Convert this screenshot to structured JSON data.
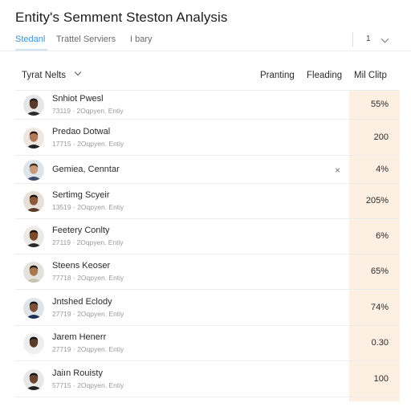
{
  "header": {
    "title": "Entity's Semment Steston Analysis"
  },
  "tabs": [
    {
      "label": "Stedanl",
      "active": true
    },
    {
      "label": "Trattel Serviers",
      "active": false
    },
    {
      "label": "I bary",
      "active": false
    }
  ],
  "pager": {
    "value": "1"
  },
  "table_header": {
    "filter_label": "Tyrat Nelts",
    "columns": [
      "Pranting",
      "Fleading",
      "Mil Clitp"
    ]
  },
  "rows": [
    {
      "name": "Snhiot Pwesl",
      "sub": "73119  ·  2Oqpyen. Entiy",
      "value": "55%",
      "avatar": {
        "skin": "#5a3a2a",
        "bg": "#e6e6e6",
        "shirt": "#2a2a2a",
        "hair": "#1a1a1a"
      }
    },
    {
      "name": "Predao Dotwal",
      "sub": "17715  ·  2Oqpyen. Entiy",
      "value": "200",
      "avatar": {
        "skin": "#b07a5a",
        "bg": "#efe6df",
        "shirt": "#222222",
        "hair": "#2a1810"
      }
    },
    {
      "name": "Gemiea, Cenntar",
      "sub": "",
      "value": "4%",
      "close": "×",
      "avatar": {
        "skin": "#c89878",
        "bg": "#dde4ec",
        "shirt": "#3a4a6a",
        "hair": "#3a2a1a"
      }
    },
    {
      "name": "Sertimg Scyeir",
      "sub": "13519  ·  2Oqpyen. Entiy",
      "value": "205%",
      "avatar": {
        "skin": "#8a5a3a",
        "bg": "#e8e0d8",
        "shirt": "#5a3a2a",
        "hair": "#1a100a"
      }
    },
    {
      "name": "Feetery Conlty",
      "sub": "27119  ·  2Oqpyen. Entiy",
      "value": "6%",
      "avatar": {
        "skin": "#7a4a2a",
        "bg": "#eceae6",
        "shirt": "#2a2a2a",
        "hair": "#151010"
      }
    },
    {
      "name": "Steens Keoser",
      "sub": "77718  ·  2Oqpyen. Entiy",
      "value": "65%",
      "avatar": {
        "skin": "#a87850",
        "bg": "#e4e2dc",
        "shirt": "#c8c2b2",
        "hair": "#1e1612"
      }
    },
    {
      "name": "Jntshed Eclody",
      "sub": "27719  ·  2Oqpyen. Entiy",
      "value": "74%",
      "avatar": {
        "skin": "#7a5038",
        "bg": "#dfe4ea",
        "shirt": "#1f2e55",
        "hair": "#141414"
      }
    },
    {
      "name": "Jarem Henerr",
      "sub": "27719  ·  2Oqpyen. Entiy",
      "value": "0.30",
      "avatar": {
        "skin": "#5a3a28",
        "bg": "#eeeeee",
        "shirt": "#f0f0f0",
        "hair": "#101010"
      }
    },
    {
      "name": "Jaiın Rouisty",
      "sub": "57715  ·  2Oqpyen. Entiy",
      "value": "100",
      "avatar": {
        "skin": "#6a4530",
        "bg": "#e8e8e8",
        "shirt": "#202020",
        "hair": "#121212"
      }
    }
  ]
}
